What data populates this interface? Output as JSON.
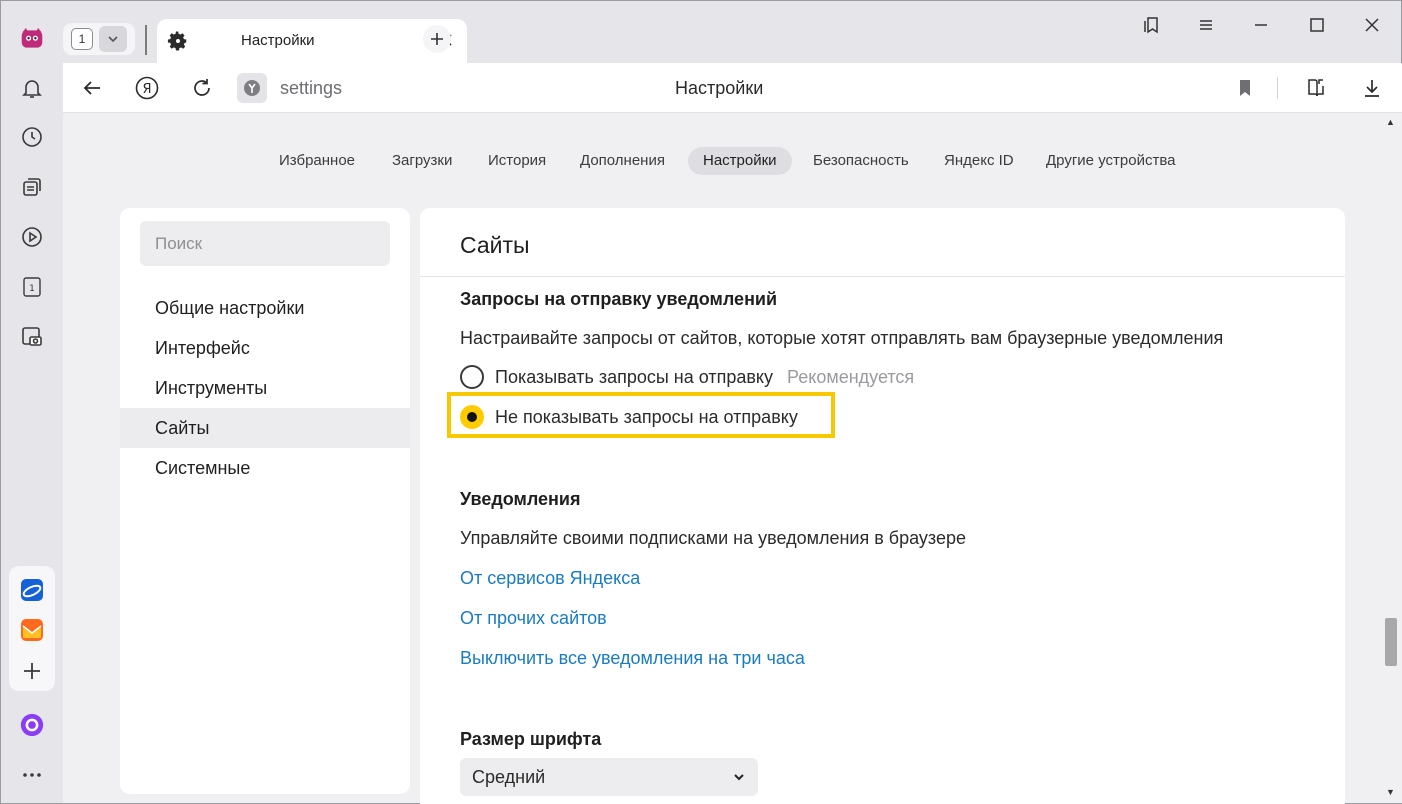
{
  "tabs": {
    "counter": "1",
    "active_title": "Настройки"
  },
  "addressbar": {
    "url": "settings",
    "page_title": "Настройки"
  },
  "topnav": {
    "items": [
      "Избранное",
      "Загрузки",
      "История",
      "Дополнения",
      "Настройки",
      "Безопасность",
      "Яндекс ID",
      "Другие устройства"
    ],
    "active": "Настройки"
  },
  "sidebar": {
    "search_placeholder": "Поиск",
    "items": [
      "Общие настройки",
      "Интерфейс",
      "Инструменты",
      "Сайты",
      "Системные"
    ],
    "active": "Сайты"
  },
  "main": {
    "title": "Сайты",
    "notification_requests": {
      "heading": "Запросы на отправку уведомлений",
      "description": "Настраивайте запросы от сайтов, которые хотят отправлять вам браузерные уведомления",
      "option_show": "Показывать запросы на отправку",
      "option_show_hint": "Рекомендуется",
      "option_hide": "Не показывать запросы на отправку",
      "selected": "option_hide"
    },
    "notifications": {
      "heading": "Уведомления",
      "description": "Управляйте своими подписками на уведомления в браузере",
      "link_yandex": "От сервисов Яндекса",
      "link_other": "От прочих сайтов",
      "link_disable": "Выключить все уведомления на три часа"
    },
    "font_size": {
      "heading": "Размер шрифта",
      "value": "Средний"
    }
  },
  "colors": {
    "accent_yellow": "#ffcc00",
    "link_blue": "#1a7bbf",
    "alice_purple": "#8b3cf7"
  }
}
